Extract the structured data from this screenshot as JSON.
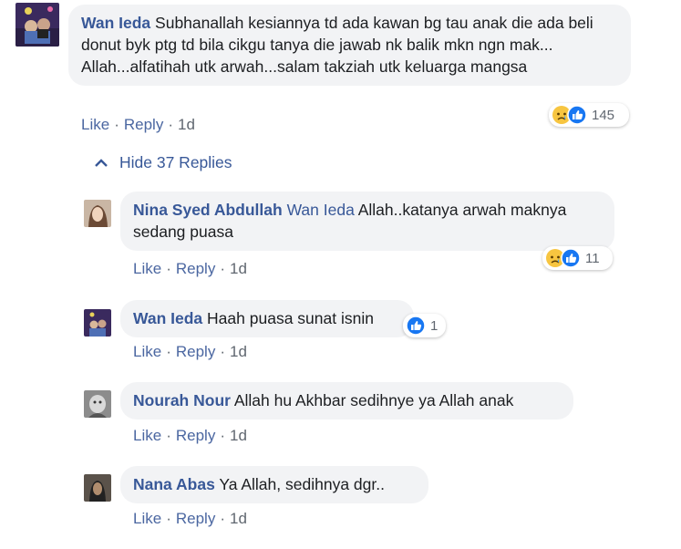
{
  "main_comment": {
    "author": "Wan Ieda",
    "text": "Subhanallah kesiannya td ada kawan bg tau anak die ada beli donut byk ptg td bila cikgu tanya die jawab nk balik mkn ngn mak... Allah...alfatihah utk arwah...salam takziah utk keluarga mangsa",
    "like": "Like",
    "reply": "Reply",
    "time": "1d",
    "reaction_count": "145",
    "reactions": [
      "sad-reaction-icon",
      "like-reaction-icon"
    ]
  },
  "hide_replies": "Hide 37 Replies",
  "replies": [
    {
      "author": "Nina Syed Abdullah",
      "mention": "Wan Ieda",
      "text": "Allah..katanya arwah maknya sedang puasa",
      "like": "Like",
      "reply": "Reply",
      "time": "1d",
      "reaction_count": "11",
      "reactions": [
        "sad-reaction-icon",
        "like-reaction-icon"
      ]
    },
    {
      "author": "Wan Ieda",
      "text": "Haah puasa sunat isnin",
      "like": "Like",
      "reply": "Reply",
      "time": "1d",
      "reaction_count": "1",
      "reactions": [
        "like-reaction-icon"
      ]
    },
    {
      "author": "Nourah Nour",
      "text": "Allah hu Akhbar sedihnye ya Allah anak",
      "like": "Like",
      "reply": "Reply",
      "time": "1d"
    },
    {
      "author": "Nana Abas",
      "text": "Ya Allah, sedihnya dgr..",
      "like": "Like",
      "reply": "Reply",
      "time": "1d"
    }
  ],
  "colors": {
    "author_link": "#385898",
    "action_link": "#4b67a1",
    "bubble_bg": "#f2f3f5",
    "like_blue": "#1877f2",
    "sad_yellow": "#f7c540"
  }
}
